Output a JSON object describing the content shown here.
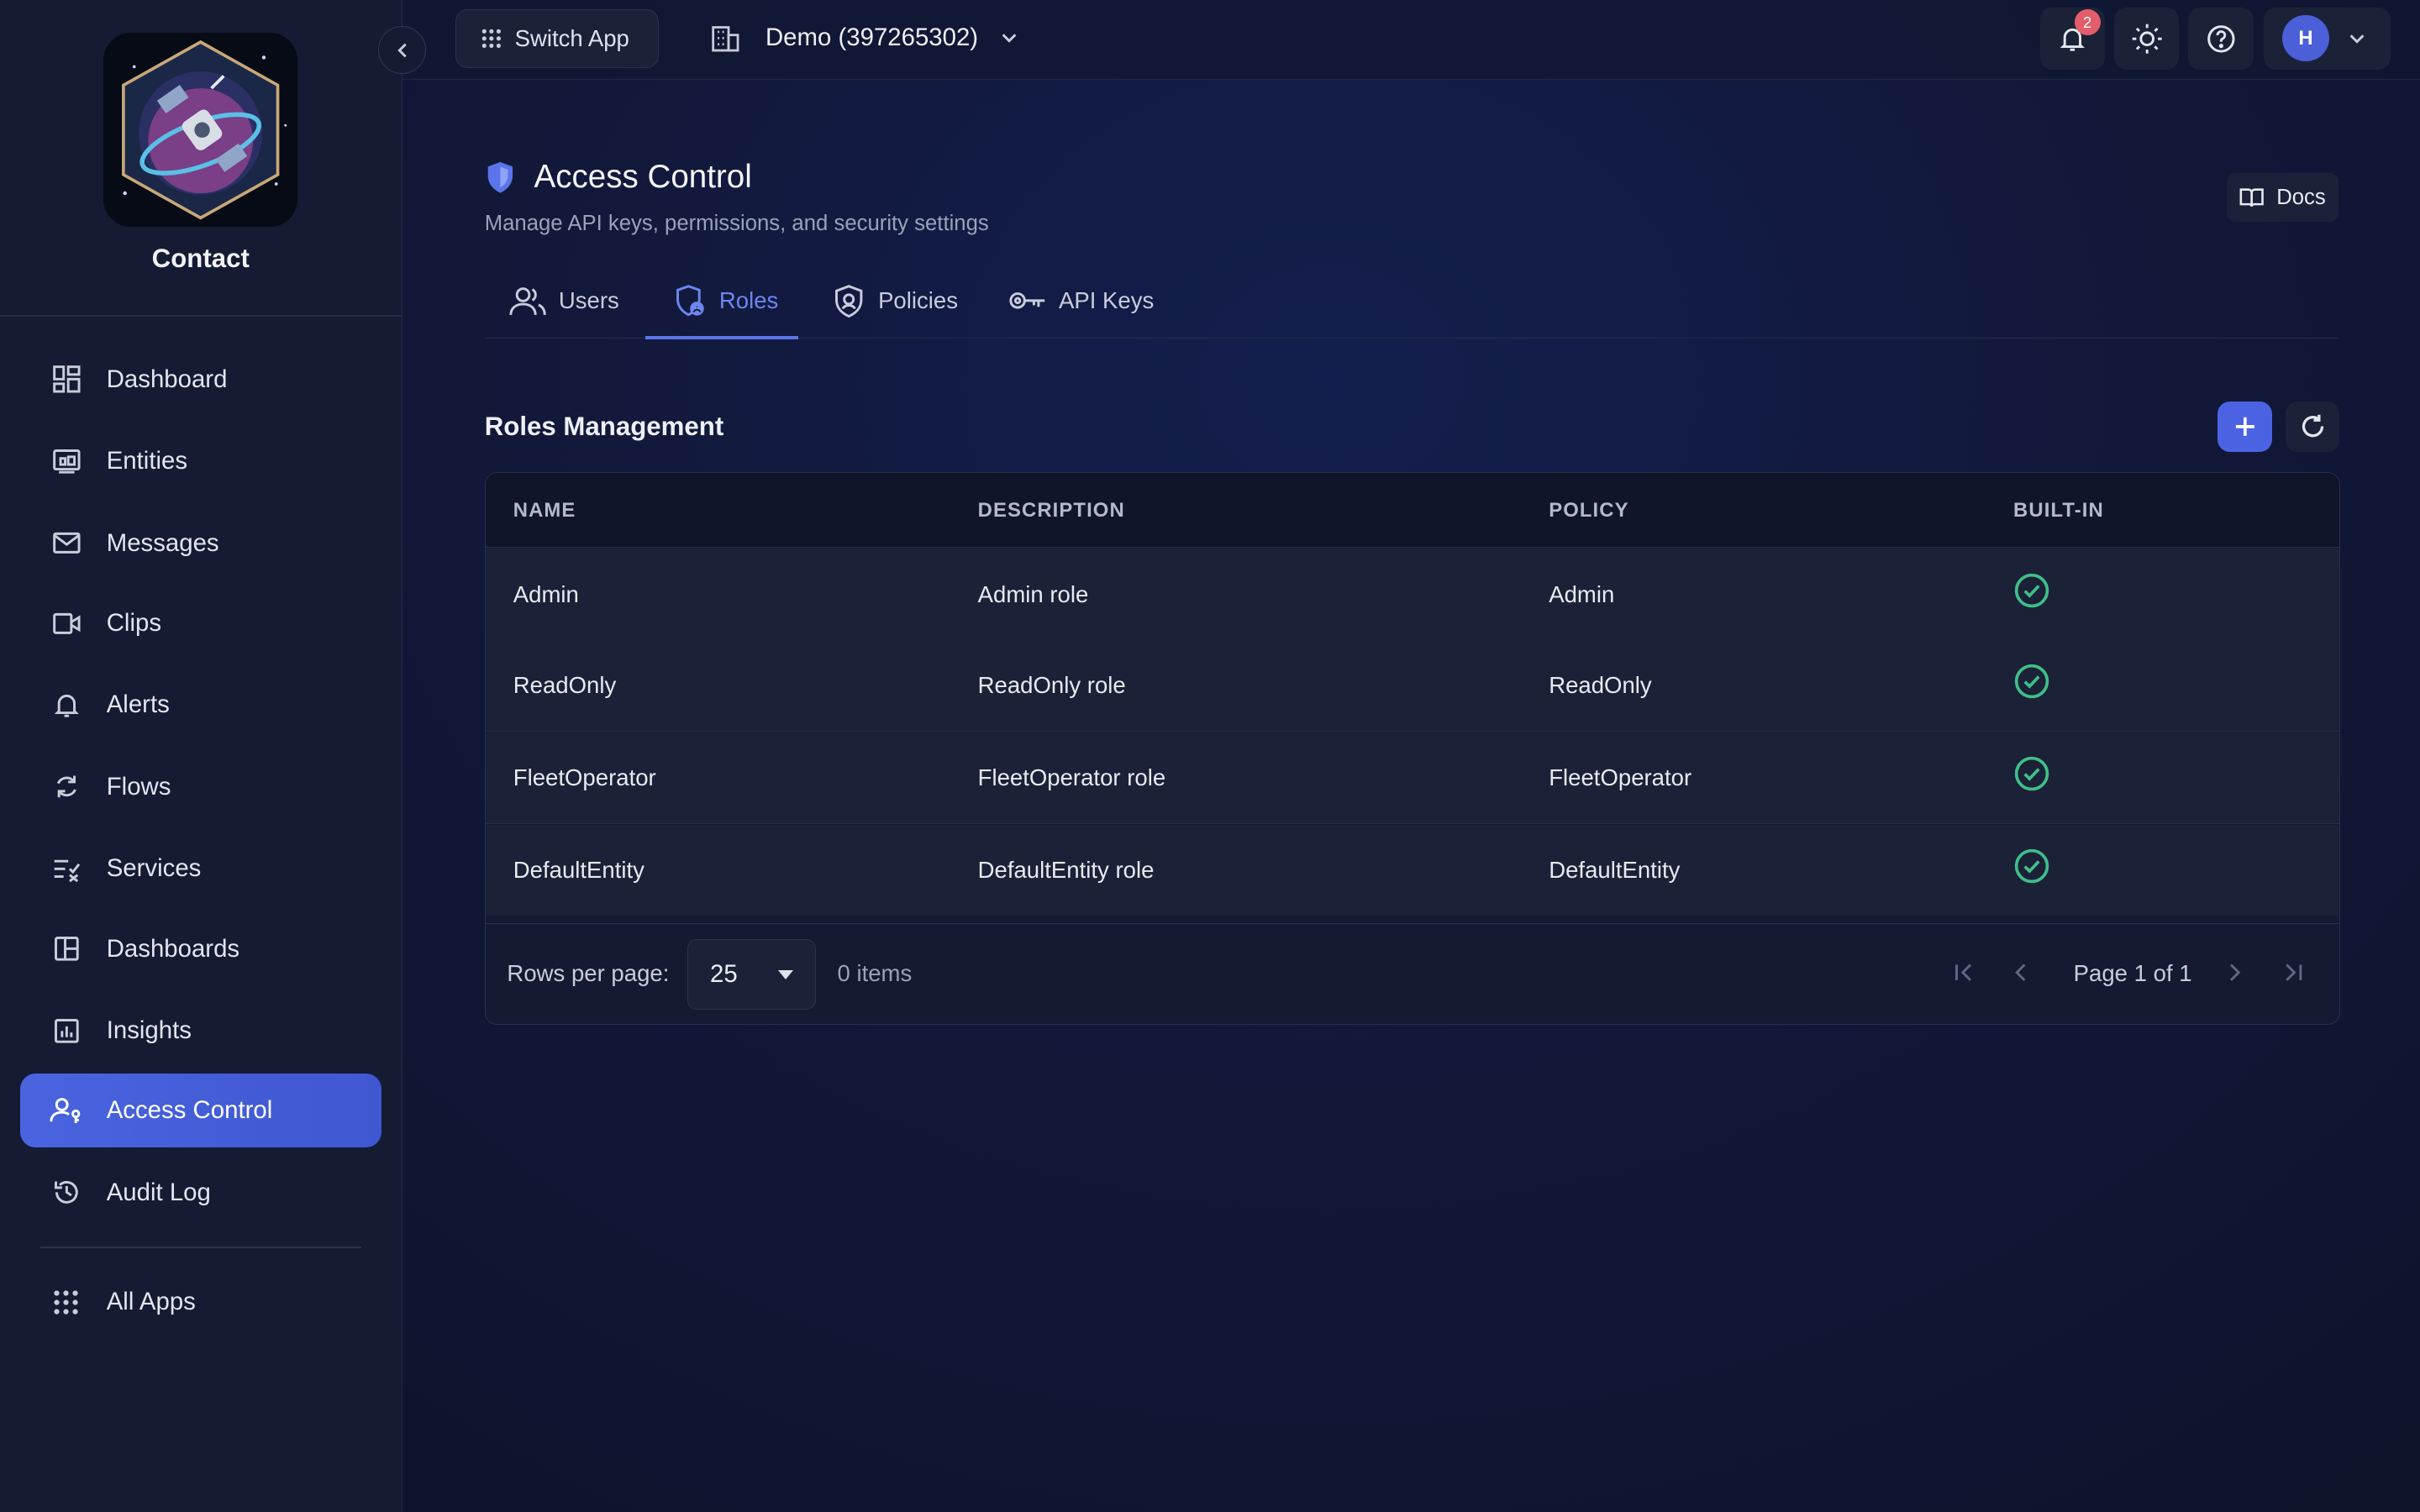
{
  "app": {
    "name": "Contact"
  },
  "topbar": {
    "switch_app_label": "Switch App",
    "org_label": "Demo (397265302)",
    "notifications_count": "2",
    "avatar_initial": "H"
  },
  "sidebar": {
    "items": [
      {
        "label": "Dashboard",
        "icon": "dashboard-icon"
      },
      {
        "label": "Entities",
        "icon": "entities-icon"
      },
      {
        "label": "Messages",
        "icon": "mail-icon"
      },
      {
        "label": "Clips",
        "icon": "video-icon"
      },
      {
        "label": "Alerts",
        "icon": "bell-icon"
      },
      {
        "label": "Flows",
        "icon": "sync-icon"
      },
      {
        "label": "Services",
        "icon": "checklist-icon"
      },
      {
        "label": "Dashboards",
        "icon": "layout-icon"
      },
      {
        "label": "Insights",
        "icon": "chart-icon"
      },
      {
        "label": "Access Control",
        "icon": "user-key-icon",
        "active": true
      },
      {
        "label": "Audit Log",
        "icon": "history-icon"
      }
    ],
    "all_apps_label": "All Apps"
  },
  "page": {
    "title": "Access Control",
    "subtitle": "Manage API keys, permissions, and security settings",
    "docs_label": "Docs"
  },
  "tabs": [
    {
      "label": "Users"
    },
    {
      "label": "Roles",
      "active": true
    },
    {
      "label": "Policies"
    },
    {
      "label": "API Keys"
    }
  ],
  "roles": {
    "section_title": "Roles Management",
    "columns": [
      "NAME",
      "DESCRIPTION",
      "POLICY",
      "BUILT-IN"
    ],
    "rows": [
      {
        "name": "Admin",
        "description": "Admin role",
        "policy": "Admin",
        "built_in": true
      },
      {
        "name": "ReadOnly",
        "description": "ReadOnly role",
        "policy": "ReadOnly",
        "built_in": true
      },
      {
        "name": "FleetOperator",
        "description": "FleetOperator role",
        "policy": "FleetOperator",
        "built_in": true
      },
      {
        "name": "DefaultEntity",
        "description": "DefaultEntity role",
        "policy": "DefaultEntity",
        "built_in": true
      }
    ]
  },
  "pagination": {
    "rows_per_page_label": "Rows per page:",
    "rows_per_page_value": "25",
    "items_count": "0 items",
    "page_info": "Page 1 of 1"
  },
  "colors": {
    "accent": "#4a64e0",
    "check": "#3fbf8a",
    "badge": "#e35d6a"
  }
}
